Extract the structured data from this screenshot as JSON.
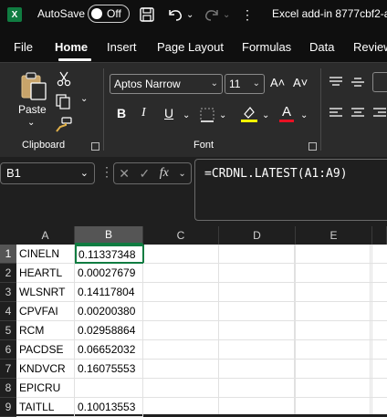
{
  "titlebar": {
    "autosave_label": "AutoSave",
    "toggle_state": "Off",
    "document_title": "Excel add-in 8777cbf2-a"
  },
  "menu": {
    "tabs": [
      {
        "label": "File",
        "active": false
      },
      {
        "label": "Home",
        "active": true
      },
      {
        "label": "Insert",
        "active": false
      },
      {
        "label": "Page Layout",
        "active": false
      },
      {
        "label": "Formulas",
        "active": false
      },
      {
        "label": "Data",
        "active": false
      },
      {
        "label": "Review",
        "active": false
      }
    ]
  },
  "ribbon": {
    "clipboard": {
      "paste_label": "Paste",
      "group_label": "Clipboard"
    },
    "font": {
      "font_name": "Aptos Narrow",
      "font_size": "11",
      "bold": "B",
      "italic": "I",
      "underline": "U",
      "grow_font": "A˄",
      "shrink_font": "A˅",
      "group_label": "Font",
      "highlight_color": "#ffff00",
      "font_color": "#e81123"
    }
  },
  "formula_bar": {
    "name_box": "B1",
    "fx_label": "fx",
    "formula": "=CRDNL.LATEST(A1:A9)"
  },
  "sheet": {
    "columns": [
      "A",
      "B",
      "C",
      "D",
      "E"
    ],
    "selected_column": "B",
    "active_cell": "B1",
    "rows": [
      {
        "num": "1",
        "a": "CINELN",
        "b": "0.11337348"
      },
      {
        "num": "2",
        "a": "HEARTL",
        "b": "0.00027679"
      },
      {
        "num": "3",
        "a": "WLSNRT",
        "b": "0.14117804"
      },
      {
        "num": "4",
        "a": "CPVFAI",
        "b": "0.00200380"
      },
      {
        "num": "5",
        "a": "RCM",
        "b": "0.02958864"
      },
      {
        "num": "6",
        "a": "PACDSE",
        "b": "0.06652032"
      },
      {
        "num": "7",
        "a": "KNDVCR",
        "b": "0.16075553"
      },
      {
        "num": "8",
        "a": "EPICRU",
        "b": ""
      },
      {
        "num": "9",
        "a": "TAITLL",
        "b": "0.10013553"
      }
    ]
  },
  "colors": {
    "accent_green": "#107c41",
    "ribbon_bg": "#2b2b2b",
    "titlebar_bg": "#0f0f0f"
  }
}
